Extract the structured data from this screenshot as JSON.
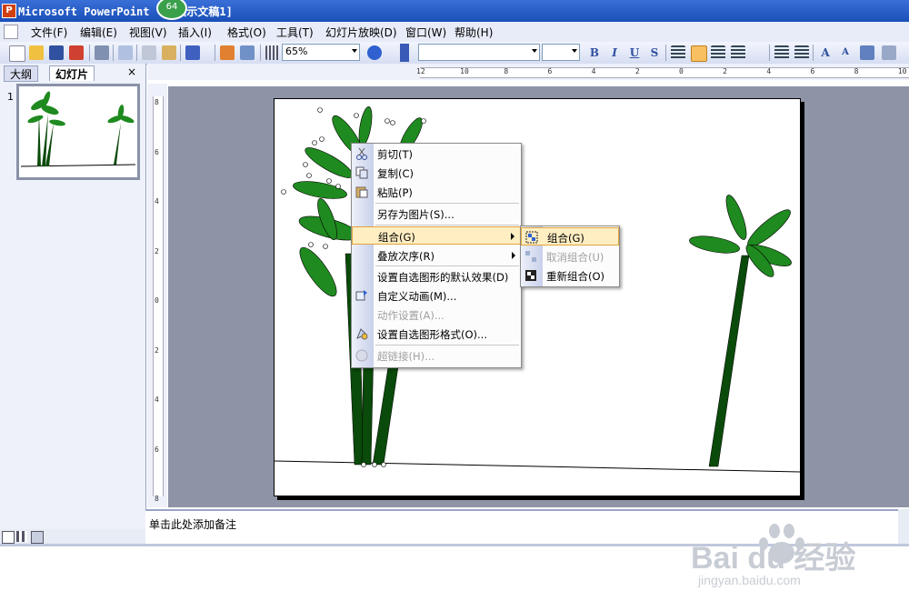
{
  "window": {
    "title": "Microsoft PowerPoint - [演示文稿1]",
    "badge": "64"
  },
  "menubar": {
    "items": [
      "文件(F)",
      "编辑(E)",
      "视图(V)",
      "插入(I)",
      "格式(O)",
      "工具(T)",
      "幻灯片放映(D)",
      "窗口(W)",
      "帮助(H)"
    ]
  },
  "toolbar": {
    "zoom": "65%"
  },
  "leftpane": {
    "tab_outline": "大纲",
    "tab_slides": "幻灯片",
    "close": "×",
    "slide_number": "1"
  },
  "ruler": {
    "h_labels": [
      "12",
      "10",
      "8",
      "6",
      "4",
      "2",
      "0",
      "2",
      "4",
      "6",
      "8",
      "10",
      "12"
    ],
    "v_labels": [
      "8",
      "6",
      "4",
      "2",
      "0",
      "2",
      "4",
      "6",
      "8"
    ]
  },
  "notes": {
    "placeholder": "单击此处添加备注"
  },
  "context_menu": {
    "items": [
      {
        "label": "剪切(T)",
        "icon": "scissors-icon",
        "disabled": false
      },
      {
        "label": "复制(C)",
        "icon": "copy-icon",
        "disabled": false
      },
      {
        "label": "粘贴(P)",
        "icon": "paste-icon",
        "disabled": false
      },
      {
        "label": "另存为图片(S)...",
        "icon": "",
        "disabled": false
      },
      {
        "label": "组合(G)",
        "icon": "",
        "disabled": false,
        "submenu": true,
        "highlighted": true
      },
      {
        "label": "叠放次序(R)",
        "icon": "",
        "disabled": false,
        "submenu": true
      },
      {
        "label": "设置自选图形的默认效果(D)",
        "icon": "",
        "disabled": false
      },
      {
        "label": "自定义动画(M)...",
        "icon": "animation-icon",
        "disabled": false
      },
      {
        "label": "动作设置(A)...",
        "icon": "",
        "disabled": true
      },
      {
        "label": "设置自选图形格式(O)...",
        "icon": "format-shape-icon",
        "disabled": false
      },
      {
        "label": "超链接(H)...",
        "icon": "hyperlink-icon",
        "disabled": true
      }
    ]
  },
  "submenu": {
    "items": [
      {
        "label": "组合(G)",
        "icon": "group-icon",
        "disabled": false,
        "highlighted": true
      },
      {
        "label": "取消组合(U)",
        "icon": "ungroup-icon",
        "disabled": true
      },
      {
        "label": "重新组合(O)",
        "icon": "regroup-icon",
        "disabled": false
      }
    ]
  },
  "watermark": {
    "brand": "Bai du 经验",
    "url": "jingyan.baidu.com"
  },
  "colors": {
    "leaf": "#1f8a1f",
    "trunk": "#0a4a0a",
    "highlight": "#ffeec2"
  }
}
